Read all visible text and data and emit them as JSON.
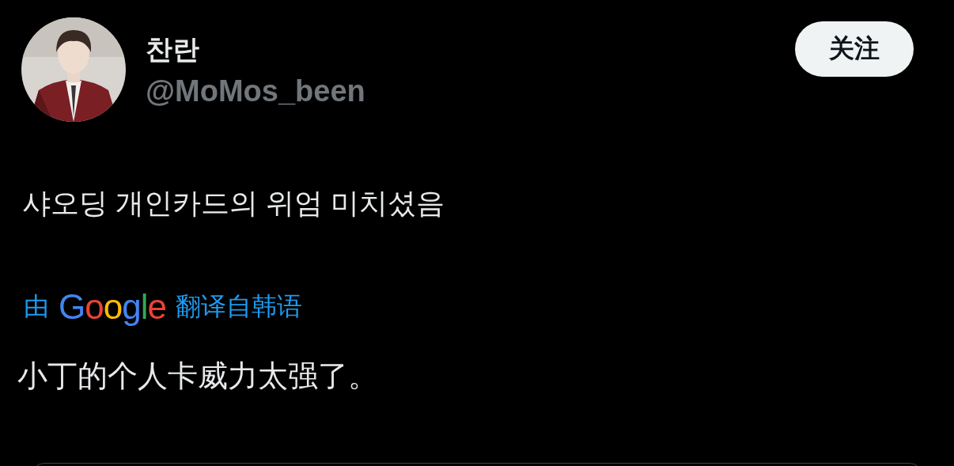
{
  "author": {
    "name": "찬란",
    "handle": "@MoMos_been"
  },
  "follow_button": {
    "label": "关注"
  },
  "post": {
    "text": "샤오딩 개인카드의 위엄 미치셨음"
  },
  "translation": {
    "prefix": "由",
    "provider": "Google",
    "suffix": "翻译自韩语",
    "text": "小丁的个人卡威力太强了。"
  }
}
